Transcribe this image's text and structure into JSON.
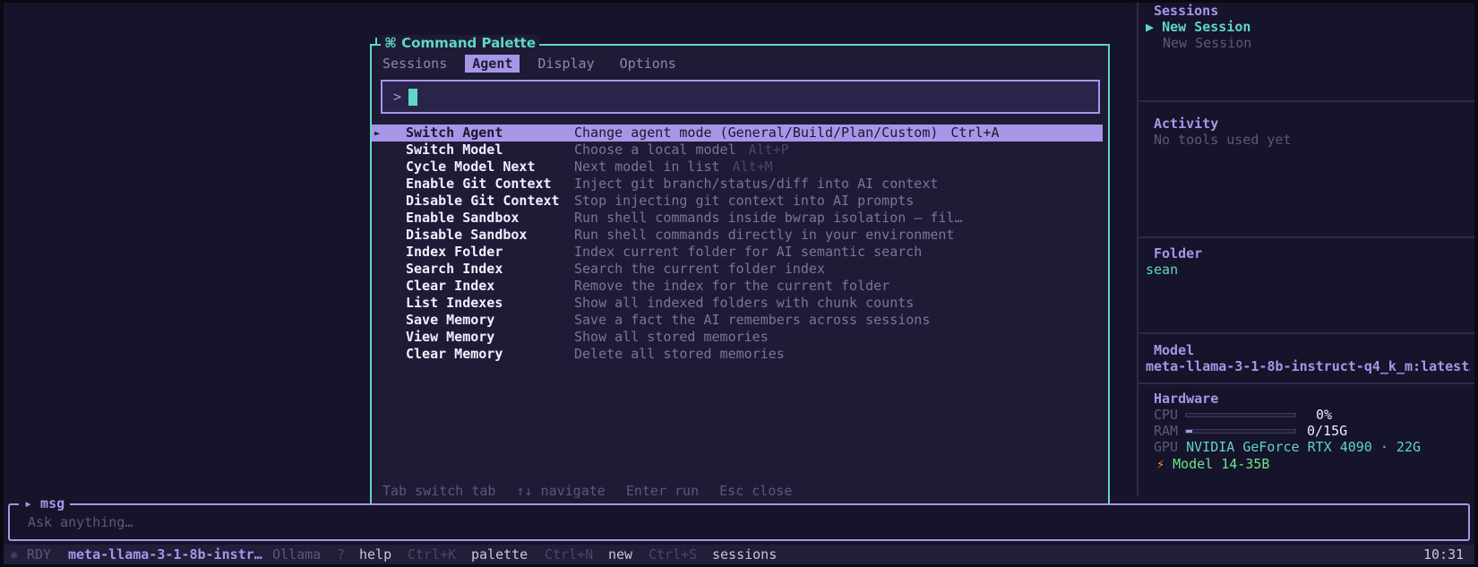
{
  "sidebar": {
    "sessions_title": "Sessions",
    "sessions": [
      {
        "label": "New Session",
        "active": true,
        "marker": "▶"
      },
      {
        "label": "New Session",
        "active": false,
        "marker": ""
      }
    ],
    "activity_title": "Activity",
    "activity_text": "No tools used yet",
    "folder_title": "Folder",
    "folder_value": "sean",
    "model_title": "Model",
    "model_value": "meta-llama-3-1-8b-instruct-q4_k_m:latest…",
    "hardware_title": "Hardware",
    "cpu_label": "CPU",
    "cpu_value": "0%",
    "cpu_usage": 0,
    "ram_label": "RAM",
    "ram_value": "0/15G",
    "ram_usage": 0.06,
    "gpu_label": "GPU",
    "gpu_value": "NVIDIA GeForce RTX 4090 · 22G",
    "model_size_icon": "⚡",
    "model_size": "Model 14-35B"
  },
  "palette": {
    "title": "⌘ Command Palette",
    "tabs": [
      {
        "label": "Sessions",
        "active": false
      },
      {
        "label": "Agent",
        "active": true
      },
      {
        "label": "Display",
        "active": false
      },
      {
        "label": "Options",
        "active": false
      }
    ],
    "search_prompt": ">",
    "search_value": "",
    "commands": [
      {
        "name": "Switch Agent",
        "desc": "Change agent mode (General/Build/Plan/Custom)",
        "key": "Ctrl+A",
        "selected": true
      },
      {
        "name": "Switch Model",
        "desc": "Choose a local model",
        "key": "Alt+P",
        "selected": false
      },
      {
        "name": "Cycle Model Next",
        "desc": "Next model in list",
        "key": "Alt+M",
        "selected": false
      },
      {
        "name": "Enable Git Context",
        "desc": "Inject git branch/status/diff into AI context",
        "key": "",
        "selected": false
      },
      {
        "name": "Disable Git Context",
        "desc": "Stop injecting git context into AI prompts",
        "key": "",
        "selected": false
      },
      {
        "name": "Enable Sandbox",
        "desc": "Run shell commands inside bwrap isolation — fil…",
        "key": "",
        "selected": false
      },
      {
        "name": "Disable Sandbox",
        "desc": "Run shell commands directly in your environment",
        "key": "",
        "selected": false
      },
      {
        "name": "Index Folder",
        "desc": "Index current folder for AI semantic search",
        "key": "",
        "selected": false
      },
      {
        "name": "Search Index",
        "desc": "Search the current folder index",
        "key": "",
        "selected": false
      },
      {
        "name": "Clear Index",
        "desc": "Remove the index for the current folder",
        "key": "",
        "selected": false
      },
      {
        "name": "List Indexes",
        "desc": "Show all indexed folders with chunk counts",
        "key": "",
        "selected": false
      },
      {
        "name": "Save Memory",
        "desc": "Save a fact the AI remembers across sessions",
        "key": "",
        "selected": false
      },
      {
        "name": "View Memory",
        "desc": "Show all stored memories",
        "key": "",
        "selected": false
      },
      {
        "name": "Clear Memory",
        "desc": "Delete all stored memories",
        "key": "",
        "selected": false
      }
    ],
    "footer": [
      "Tab switch tab",
      "↑↓ navigate",
      "Enter run",
      "Esc close"
    ]
  },
  "msg": {
    "label": "▸ msg",
    "placeholder": "Ask anything…"
  },
  "statusbar": {
    "status_dot": "●",
    "status": "RDY",
    "model": "meta-llama-3-1-8b-instr…",
    "provider": "Ollama",
    "shortcuts": [
      {
        "key": "?",
        "label": "help"
      },
      {
        "key": "Ctrl+K",
        "label": "palette"
      },
      {
        "key": "Ctrl+N",
        "label": "new"
      },
      {
        "key": "Ctrl+S",
        "label": "sessions"
      }
    ],
    "time": "10:31"
  },
  "colors": {
    "accent": "#a995e8",
    "teal": "#5fd6c8",
    "background": "#16142a",
    "palette_bg": "#1e1b36"
  }
}
